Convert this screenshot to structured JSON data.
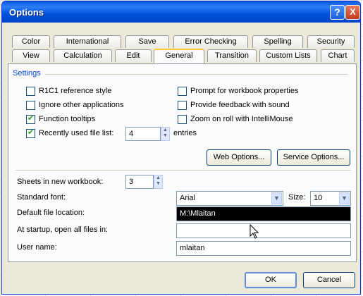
{
  "window": {
    "title": "Options"
  },
  "titlebar": {
    "help_glyph": "?",
    "close_glyph": "X"
  },
  "tabs_row1": [
    {
      "label": "Color"
    },
    {
      "label": "International"
    },
    {
      "label": "Save"
    },
    {
      "label": "Error Checking"
    },
    {
      "label": "Spelling"
    },
    {
      "label": "Security"
    }
  ],
  "tabs_row2": [
    {
      "label": "View"
    },
    {
      "label": "Calculation"
    },
    {
      "label": "Edit"
    },
    {
      "label": "General",
      "selected": true
    },
    {
      "label": "Transition"
    },
    {
      "label": "Custom Lists"
    },
    {
      "label": "Chart"
    }
  ],
  "settings": {
    "group_label": "Settings",
    "left_options": [
      {
        "label": "R1C1 reference style",
        "checked": false
      },
      {
        "label": "Ignore other applications",
        "checked": false
      },
      {
        "label": "Function tooltips",
        "checked": true
      },
      {
        "label": "Recently used file list:",
        "checked": true
      }
    ],
    "right_options": [
      {
        "label": "Prompt for workbook properties",
        "checked": false
      },
      {
        "label": "Provide feedback with sound",
        "checked": false
      },
      {
        "label": "Zoom on roll with IntelliMouse",
        "checked": false
      }
    ],
    "recent_files_count": "4",
    "entries_label": "entries",
    "web_options_label": "Web Options...",
    "service_options_label": "Service Options..."
  },
  "workbook": {
    "sheets_label": "Sheets in new workbook:",
    "sheets_value": "3",
    "standard_font_label": "Standard font:",
    "standard_font_value": "Arial",
    "size_label": "Size:",
    "size_value": "10",
    "default_location_label": "Default file location:",
    "default_location_value": "M:\\Mlaitan",
    "startup_label": "At startup, open all files in:",
    "startup_value": "",
    "user_name_label": "User name:",
    "user_name_value": "mlaitan"
  },
  "footer": {
    "ok_label": "OK",
    "cancel_label": "Cancel"
  },
  "icons": {
    "dropdown": "chevron-down-icon",
    "spinner": "spinner-icon",
    "cursor": "mouse-cursor-icon"
  }
}
